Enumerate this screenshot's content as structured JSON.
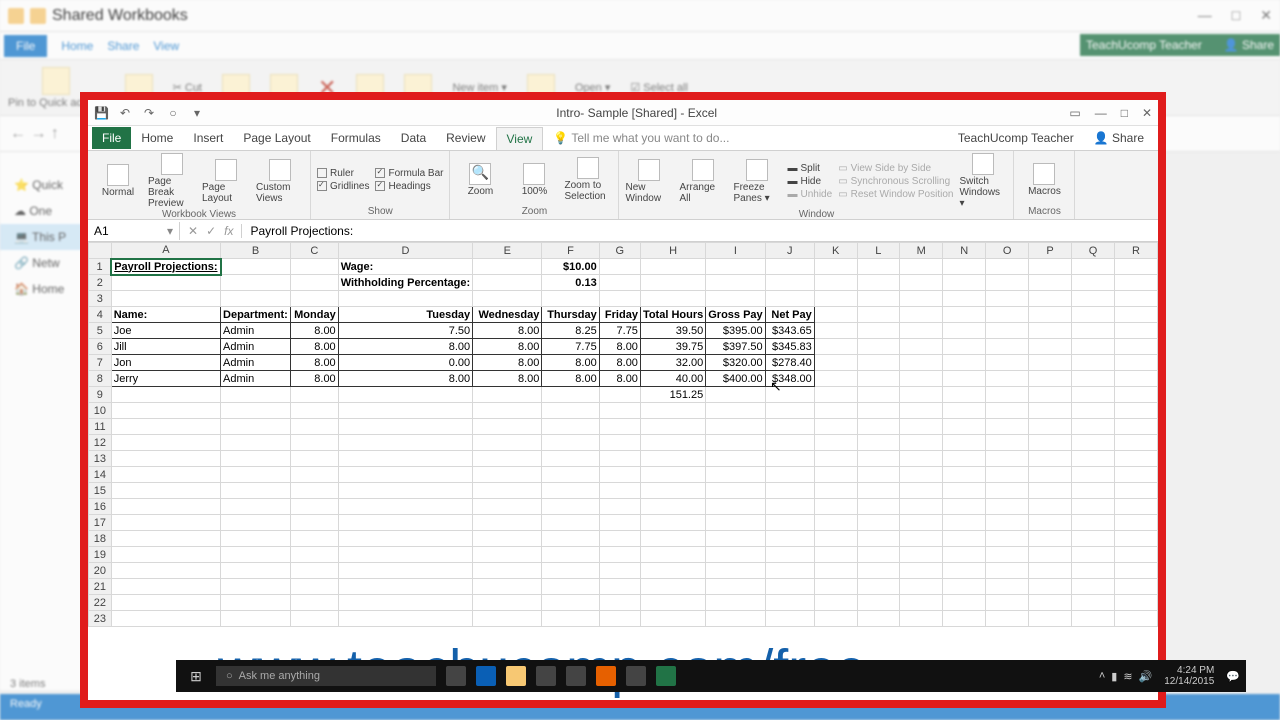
{
  "bg": {
    "title": "Shared Workbooks",
    "tabs": {
      "file": "File",
      "home": "Home",
      "share": "Share",
      "view": "View"
    },
    "tools": {
      "pin": "Pin to Quick access",
      "cut": "Cut",
      "newitem": "New item ▾",
      "open": "Open ▾",
      "selectall": "Select all"
    },
    "side": {
      "quick": "⭐ Quick",
      "one": "☁ One",
      "pc": "💻 This P",
      "net": "🔗 Netw",
      "home": "🏠 Home"
    },
    "items": "3 items",
    "ready": "Ready",
    "user": "TeachUcomp Teacher",
    "share": "Share"
  },
  "excel": {
    "title": "Intro- Sample [Shared] - Excel",
    "ribbon": {
      "file": "File",
      "home": "Home",
      "insert": "Insert",
      "pagelayout": "Page Layout",
      "formulas": "Formulas",
      "data": "Data",
      "review": "Review",
      "view": "View",
      "tell": "Tell me what you want to do...",
      "user": "TeachUcomp Teacher",
      "share": "Share"
    },
    "view": {
      "normal": "Normal",
      "pagebreak": "Page Break Preview",
      "pagelayout": "Page Layout",
      "custom": "Custom Views",
      "wbviews": "Workbook Views",
      "ruler": "Ruler",
      "fbar": "Formula Bar",
      "gridlines": "Gridlines",
      "headings": "Headings",
      "show": "Show",
      "zoom": "Zoom",
      "p100": "100%",
      "zoomsel": "Zoom to Selection",
      "zoomg": "Zoom",
      "newwin": "New Window",
      "arrange": "Arrange All",
      "freeze": "Freeze Panes ▾",
      "split": "Split",
      "hide": "Hide",
      "unhide": "Unhide",
      "sbs": "View Side by Side",
      "sync": "Synchronous Scrolling",
      "reset": "Reset Window Position",
      "switch": "Switch Windows ▾",
      "windowg": "Window",
      "macros": "Macros",
      "macrosg": "Macros"
    },
    "namebox": "A1",
    "formula": "Payroll Projections:",
    "cols": [
      "A",
      "B",
      "C",
      "D",
      "E",
      "F",
      "G",
      "H",
      "I",
      "J",
      "K",
      "L",
      "M",
      "N",
      "O",
      "P",
      "Q",
      "R"
    ],
    "rows": [
      "1",
      "2",
      "3",
      "4",
      "5",
      "6",
      "7",
      "8",
      "9",
      "10",
      "11",
      "12",
      "13",
      "14",
      "15",
      "16",
      "17",
      "18",
      "19",
      "20",
      "21",
      "22",
      "23"
    ],
    "cells": {
      "a1": "Payroll Projections:",
      "d1": "Wage:",
      "f1": "$10.00",
      "d2": "Withholding Percentage:",
      "f2": "0.13",
      "a4": "Name:",
      "b4": "Department:",
      "c4": "Monday",
      "d4": "Tuesday",
      "e4": "Wednesday",
      "f4": "Thursday",
      "g4": "Friday",
      "h4": "Total Hours",
      "i4": "Gross Pay",
      "j4": "Net Pay",
      "a5": "Joe",
      "b5": "Admin",
      "c5": "8.00",
      "d5": "7.50",
      "e5": "8.00",
      "f5": "8.25",
      "g5": "7.75",
      "h5": "39.50",
      "i5": "$395.00",
      "j5": "$343.65",
      "a6": "Jill",
      "b6": "Admin",
      "c6": "8.00",
      "d6": "8.00",
      "e6": "8.00",
      "f6": "7.75",
      "g6": "8.00",
      "h6": "39.75",
      "i6": "$397.50",
      "j6": "$345.83",
      "a7": "Jon",
      "b7": "Admin",
      "c7": "8.00",
      "d7": "0.00",
      "e7": "8.00",
      "f7": "8.00",
      "g7": "8.00",
      "h7": "32.00",
      "i7": "$320.00",
      "j7": "$278.40",
      "a8": "Jerry",
      "b8": "Admin",
      "c8": "8.00",
      "d8": "8.00",
      "e8": "8.00",
      "f8": "8.00",
      "g8": "8.00",
      "h8": "40.00",
      "i8": "$400.00",
      "j8": "$348.00",
      "h9": "151.25"
    }
  },
  "url": "www.teachucomp.com/free",
  "taskbar": {
    "search": "Ask me anything",
    "time": "4:24 PM",
    "date": "12/14/2015"
  }
}
